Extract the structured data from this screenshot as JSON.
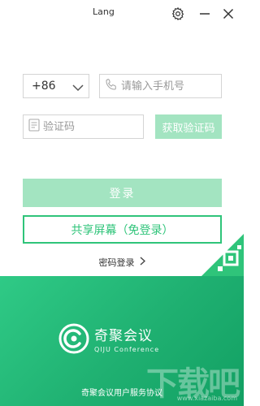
{
  "header": {
    "language": "Lang",
    "settings_icon": "gear-icon",
    "minimize_icon": "minimize-icon",
    "close_icon": "close-icon"
  },
  "login_form": {
    "country_code": "+86",
    "phone_placeholder": "请输入手机号",
    "phone_value": "",
    "code_placeholder": "验证码",
    "code_value": "",
    "get_code_label": "获取验证码",
    "login_label": "登录",
    "share_screen_label": "共享屏幕（免登录）",
    "password_login_label": "密码登录"
  },
  "footer": {
    "brand_name": "奇聚会议",
    "brand_subtitle": "QIJU Conference",
    "agreement_label": "奇聚会议用户服务协议",
    "watermark": "下载吧",
    "watermark_url": "www.xiazaiba.com"
  },
  "colors": {
    "accent": "#2fc47a",
    "accent_light": "#a3e4c1",
    "footer_bg": "#1fb071",
    "border": "#d4d4d4"
  }
}
